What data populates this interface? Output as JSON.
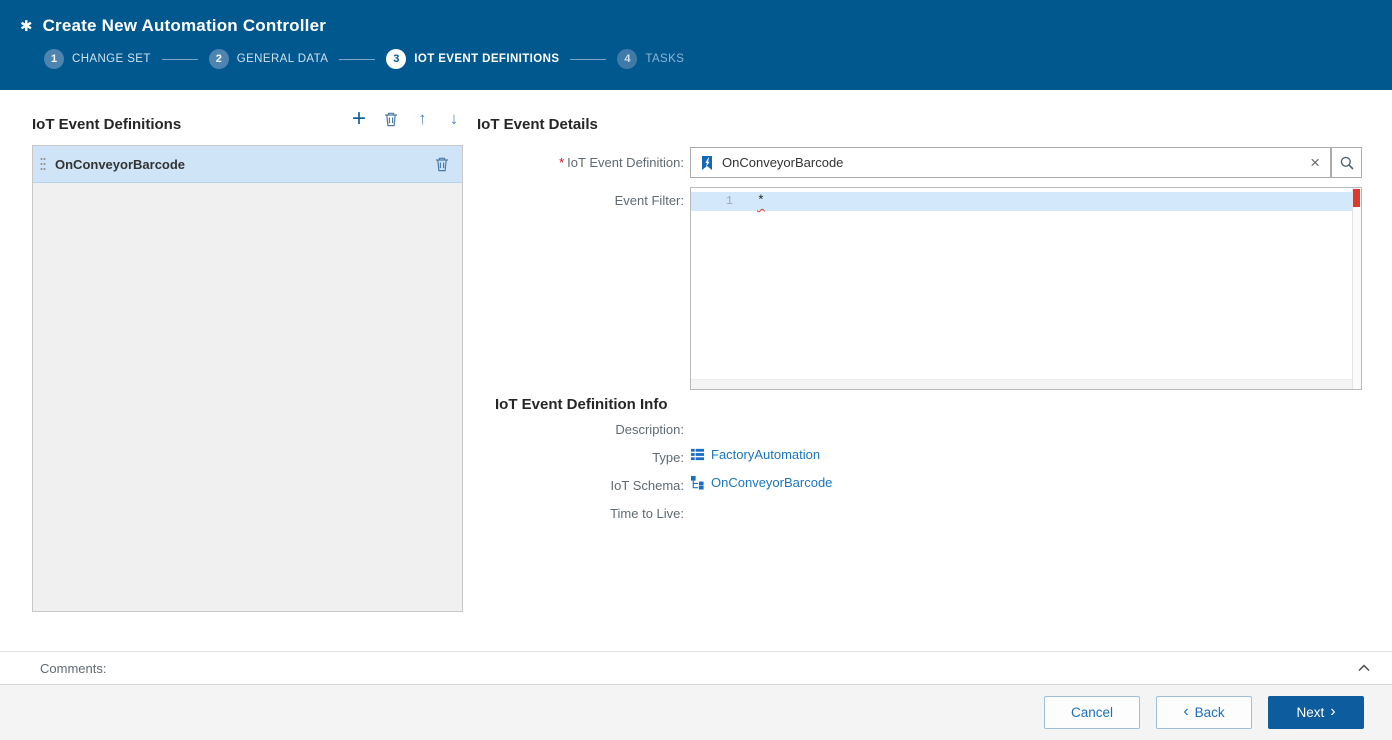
{
  "colors": {
    "header_bg": "#00588f",
    "accent_blue": "#1b75bc",
    "selection_blue": "#cfe5f7",
    "error_red": "#dd3a2e",
    "primary_button_bg": "#0d5c9e"
  },
  "header": {
    "icon_glyph": "✱",
    "title": "Create New Automation Controller"
  },
  "wizard": {
    "active_step": "3",
    "steps": [
      {
        "number": "1",
        "label": "CHANGE SET"
      },
      {
        "number": "2",
        "label": "GENERAL DATA"
      },
      {
        "number": "3",
        "label": "IOT EVENT DEFINITIONS"
      },
      {
        "number": "4",
        "label": "TASKS"
      }
    ]
  },
  "event_list": {
    "title": "IoT Event Definitions",
    "toolbar": {
      "add_glyph": "+",
      "up_glyph": "↑",
      "down_glyph": "↓"
    },
    "items": [
      {
        "label": "OnConveyorBarcode",
        "selected": true
      }
    ]
  },
  "details": {
    "title": "IoT Event Details",
    "required_marker": "*",
    "definition_field": {
      "label": "IoT Event Definition:",
      "value": "OnConveyorBarcode",
      "clear_glyph": "×"
    },
    "event_filter": {
      "label": "Event Filter:",
      "line_number": "1",
      "code": "*"
    },
    "info": {
      "title": "IoT Event Definition Info",
      "rows": [
        {
          "label": "Description:",
          "value": ""
        },
        {
          "label": "Type:",
          "value": "FactoryAutomation"
        },
        {
          "label": "IoT Schema:",
          "value": "OnConveyorBarcode"
        },
        {
          "label": "Time to Live:",
          "value": ""
        }
      ]
    }
  },
  "comments": {
    "label": "Comments:"
  },
  "footer": {
    "cancel_label": "Cancel",
    "back_glyph": "‹",
    "back_label": "Back",
    "next_label": "Next",
    "next_glyph": "›"
  }
}
